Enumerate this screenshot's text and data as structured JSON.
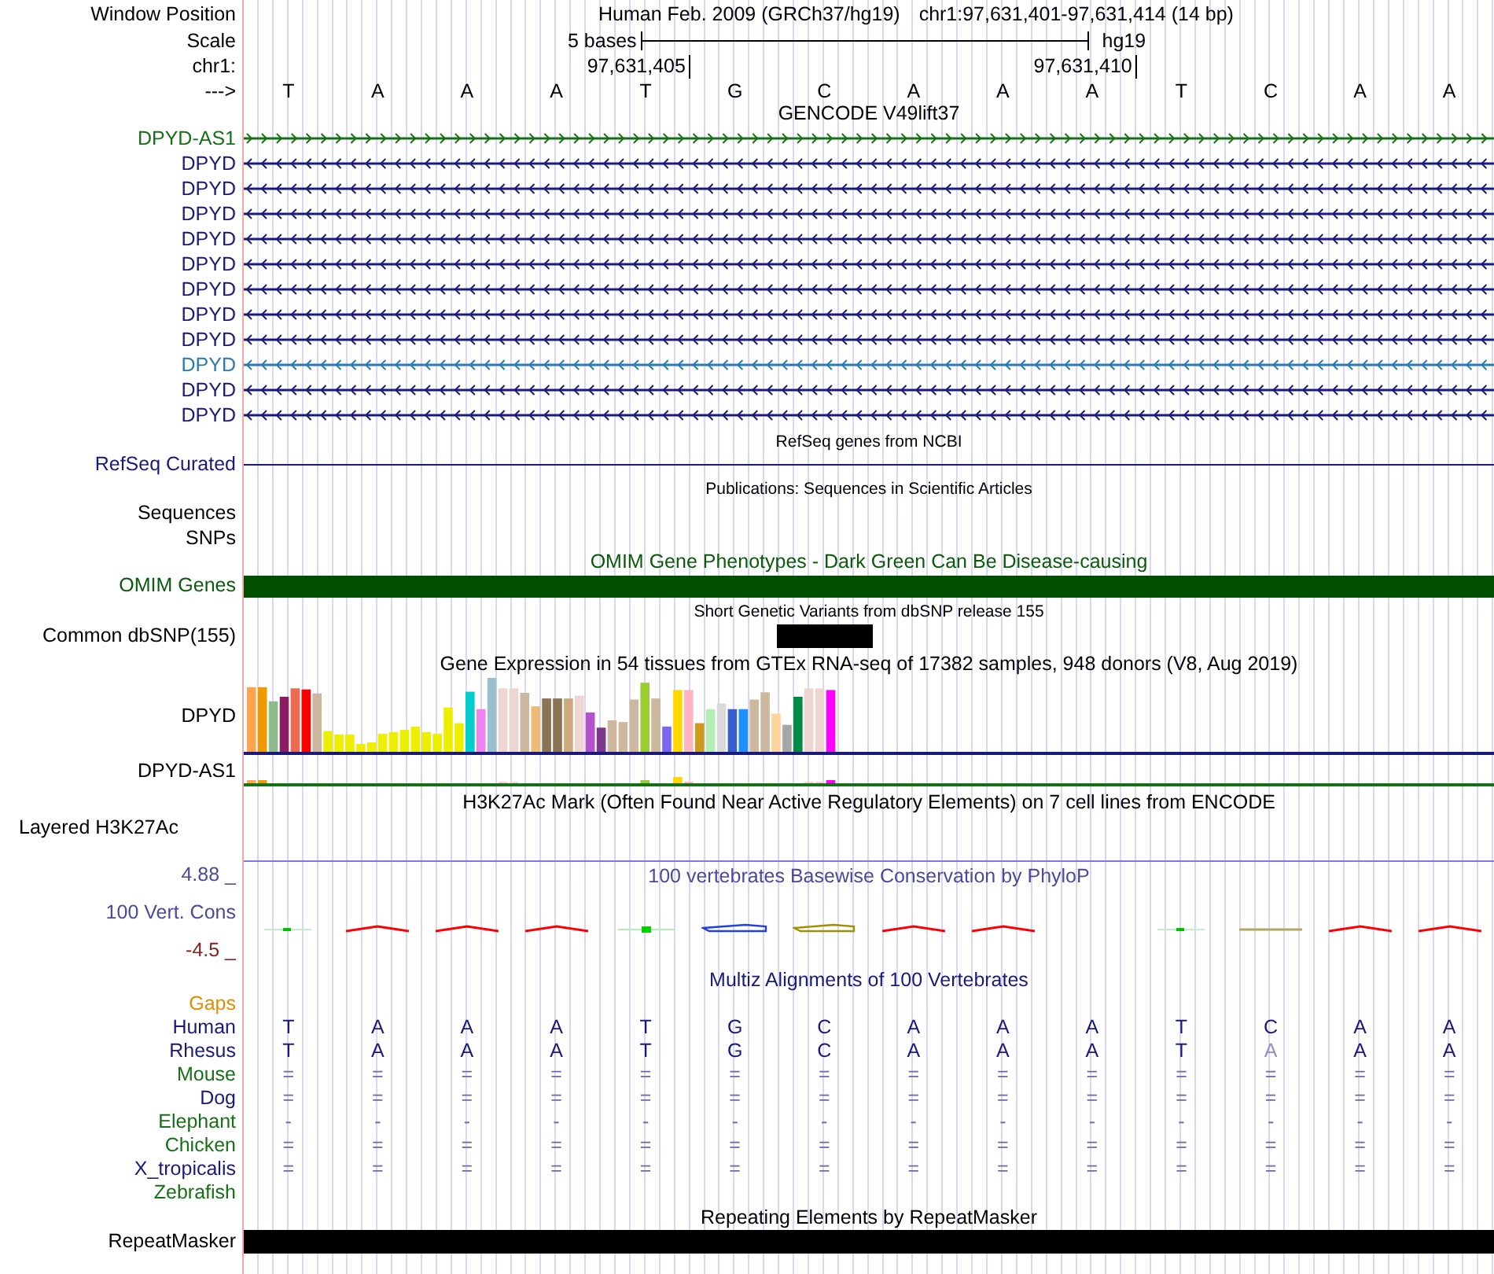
{
  "position": {
    "label": "Window Position",
    "assembly": "Human Feb. 2009 (GRCh37/hg19)",
    "range": "chr1:97,631,401-97,631,414 (14 bp)"
  },
  "scale": {
    "label": "Scale",
    "length": "5 bases",
    "assembly": "hg19"
  },
  "ruler": {
    "label": "chr1:",
    "ticks": [
      "97,631,405",
      "97,631,410"
    ]
  },
  "sequence": {
    "label": "--->",
    "bases": [
      "T",
      "A",
      "A",
      "A",
      "T",
      "G",
      "C",
      "A",
      "A",
      "A",
      "T",
      "C",
      "A",
      "A"
    ]
  },
  "tracks": [
    {
      "kind": "genes",
      "title": "GENCODE V49lift37",
      "items": [
        {
          "name": "DPYD-AS1",
          "forward": true,
          "color": "#167016"
        },
        {
          "name": "DPYD",
          "forward": false,
          "color": "#1a1a7a"
        },
        {
          "name": "DPYD",
          "forward": false,
          "color": "#1a1a7a"
        },
        {
          "name": "DPYD",
          "forward": false,
          "color": "#1a1a7a"
        },
        {
          "name": "DPYD",
          "forward": false,
          "color": "#1a1a7a"
        },
        {
          "name": "DPYD",
          "forward": false,
          "color": "#1a1a7a"
        },
        {
          "name": "DPYD",
          "forward": false,
          "color": "#1a1a7a"
        },
        {
          "name": "DPYD",
          "forward": false,
          "color": "#1a1a7a"
        },
        {
          "name": "DPYD",
          "forward": false,
          "color": "#1a1a7a"
        },
        {
          "name": "DPYD",
          "forward": false,
          "color": "#2a7ab4"
        },
        {
          "name": "DPYD",
          "forward": false,
          "color": "#1a1a7a"
        },
        {
          "name": "DPYD",
          "forward": false,
          "color": "#1a1a7a"
        }
      ]
    },
    {
      "kind": "line",
      "title": "RefSeq genes from NCBI",
      "label": "RefSeq Curated"
    },
    {
      "kind": "empty",
      "title": "Publications: Sequences in Scientific Articles",
      "labels": [
        "Sequences",
        "SNPs"
      ]
    },
    {
      "kind": "bar",
      "title": "OMIM Gene Phenotypes - Dark Green Can Be Disease-causing",
      "label": "OMIM Genes"
    },
    {
      "kind": "variant",
      "title": "Short Genetic Variants from dbSNP release 155",
      "label": "Common dbSNP(155)"
    },
    {
      "kind": "expression",
      "title": "Gene Expression in 54 tissues from GTEx RNA-seq of 17382 samples, 948 donors (V8, Aug 2019)",
      "rows": [
        {
          "name": "DPYD",
          "color": "#1a1a7a"
        },
        {
          "name": "DPYD-AS1",
          "color": "#167016"
        }
      ]
    },
    {
      "kind": "layered",
      "title": "H3K27Ac Mark (Often Found Near Active Regulatory Elements) on 7 cell lines from ENCODE",
      "label": "Layered H3K27Ac"
    },
    {
      "kind": "wiggle",
      "title": "100 vertebrates Basewise Conservation by PhyloP",
      "label": "100 Vert. Cons",
      "max": "4.88 _",
      "min": "-4.5 _"
    },
    {
      "kind": "multiz",
      "title": "Multiz Alignments of 100 Vertebrates",
      "gaps": "Gaps",
      "species": [
        {
          "name": "Human",
          "color": "#1a1a7a",
          "bases": [
            "T",
            "A",
            "A",
            "A",
            "T",
            "G",
            "C",
            "A",
            "A",
            "A",
            "T",
            "C",
            "A",
            "A"
          ]
        },
        {
          "name": "Rhesus",
          "color": "#1a1a7a",
          "bases": [
            "T",
            "A",
            "A",
            "A",
            "T",
            "G",
            "C",
            "A",
            "A",
            "A",
            "T",
            {
              "text": "A",
              "mismatch": true
            },
            "A",
            "A"
          ]
        },
        {
          "name": "Mouse",
          "color": "#167016",
          "bases": [
            "=",
            "=",
            "=",
            "=",
            "=",
            "=",
            "=",
            "=",
            "=",
            "=",
            "=",
            "=",
            "=",
            "="
          ]
        },
        {
          "name": "Dog",
          "color": "#1a1a7a",
          "bases": [
            "=",
            "=",
            "=",
            "=",
            "=",
            "=",
            "=",
            "=",
            "=",
            "=",
            "=",
            "=",
            "=",
            "="
          ]
        },
        {
          "name": "Elephant",
          "color": "#167016",
          "bases": [
            "-",
            "-",
            "-",
            "-",
            "-",
            "-",
            "-",
            "-",
            "-",
            "-",
            "-",
            "-",
            "-",
            "-"
          ]
        },
        {
          "name": "Chicken",
          "color": "#167016",
          "bases": [
            "=",
            "=",
            "=",
            "=",
            "=",
            "=",
            "=",
            "=",
            "=",
            "=",
            "=",
            "=",
            "=",
            "="
          ]
        },
        {
          "name": "X_tropicalis",
          "color": "#1a1a7a",
          "bases": [
            "=",
            "=",
            "=",
            "=",
            "=",
            "=",
            "=",
            "=",
            "=",
            "=",
            "=",
            "=",
            "=",
            "="
          ]
        },
        {
          "name": "Zebrafish",
          "color": "#167016"
        }
      ]
    },
    {
      "kind": "repeat",
      "title": "Repeating Elements by RepeatMasker",
      "label": "RepeatMasker"
    }
  ]
}
